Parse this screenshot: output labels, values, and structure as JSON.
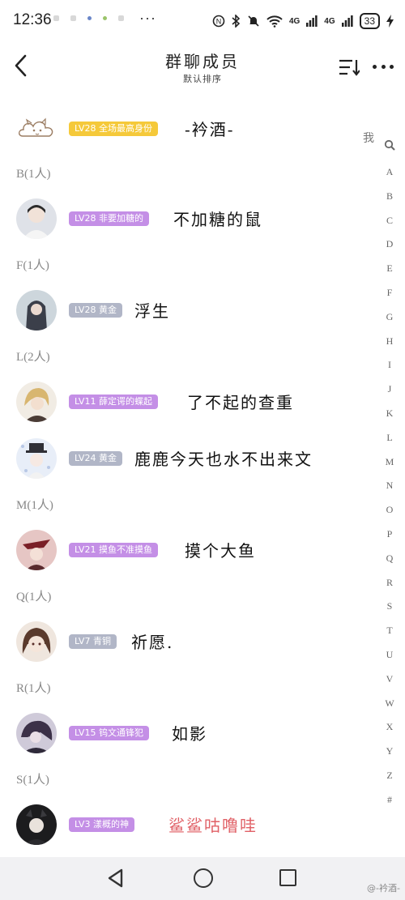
{
  "status_bar": {
    "time": "12:36",
    "more": "···",
    "battery": "33",
    "network_1": "4G",
    "network_2": "4G"
  },
  "header": {
    "title": "群聊成员",
    "subtitle": "默认排序"
  },
  "self_row": {
    "badge": "LV28 全场最高身份",
    "name": "-衿酒-",
    "me_label": "我"
  },
  "sections": [
    {
      "head": "B(1人)"
    },
    {
      "head": "F(1人)"
    },
    {
      "head": "L(2人)"
    },
    {
      "head": "M(1人)"
    },
    {
      "head": "Q(1人)"
    },
    {
      "head": "R(1人)"
    },
    {
      "head": "S(1人)"
    }
  ],
  "members": [
    {
      "badge": "LV28 非要加糖的",
      "name": "不加糖的鼠"
    },
    {
      "badge": "LV28 黄金",
      "name": "浮生"
    },
    {
      "badge": "LV11 薛定谔的蝶起",
      "name": "了不起的查重"
    },
    {
      "badge": "LV24 黄金",
      "name": "鹿鹿今天也水不出来文"
    },
    {
      "badge": "LV21 摸鱼不准摸鱼",
      "name": "摸个大鱼"
    },
    {
      "badge": "LV7 青铜",
      "name": "祈愿."
    },
    {
      "badge": "LV15 钨文通锋犯",
      "name": "如影"
    },
    {
      "badge": "LV3 漾概的神",
      "name": "鲨鲨咕噜哇"
    }
  ],
  "alpha_index": [
    "A",
    "B",
    "C",
    "D",
    "E",
    "F",
    "G",
    "H",
    "I",
    "J",
    "K",
    "L",
    "M",
    "N",
    "O",
    "P",
    "Q",
    "R",
    "S",
    "T",
    "U",
    "V",
    "W",
    "X",
    "Y",
    "Z",
    "#"
  ],
  "watermark": "@-衿酒-",
  "colors": {
    "badge_gold": "#f5c93a",
    "badge_purple": "#c48fe6",
    "badge_gray": "#b1b6c7",
    "name_pink": "#e06066"
  }
}
